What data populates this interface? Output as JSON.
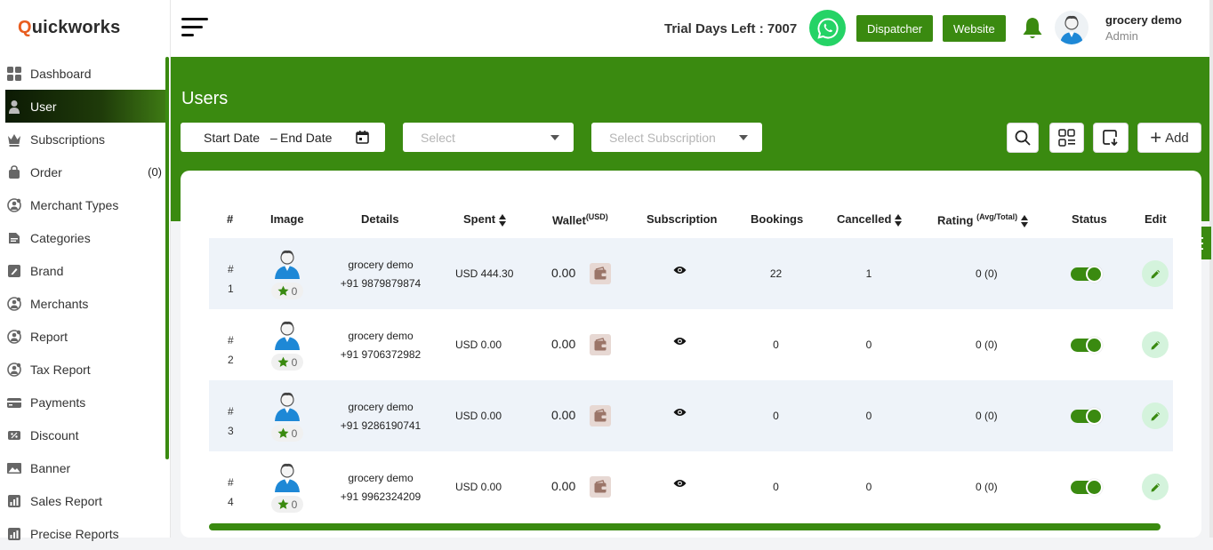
{
  "brand": {
    "q": "Q",
    "rest": "uickworks"
  },
  "sidebar": {
    "items": [
      {
        "label": "Dashboard",
        "icon": "dashboard-icon"
      },
      {
        "label": "User",
        "icon": "user-icon",
        "active": true
      },
      {
        "label": "Subscriptions",
        "icon": "crown-icon"
      },
      {
        "label": "Order",
        "icon": "bag-icon",
        "count": "(0)"
      },
      {
        "label": "Merchant Types",
        "icon": "merchant-type-icon"
      },
      {
        "label": "Categories",
        "icon": "categories-icon"
      },
      {
        "label": "Brand",
        "icon": "brand-icon"
      },
      {
        "label": "Merchants",
        "icon": "merchants-icon"
      },
      {
        "label": "Report",
        "icon": "report-icon"
      },
      {
        "label": "Tax Report",
        "icon": "tax-report-icon"
      },
      {
        "label": "Payments",
        "icon": "payments-icon"
      },
      {
        "label": "Discount",
        "icon": "discount-icon"
      },
      {
        "label": "Banner",
        "icon": "banner-icon"
      },
      {
        "label": "Sales Report",
        "icon": "sales-report-icon"
      },
      {
        "label": "Precise Reports",
        "icon": "precise-reports-icon"
      }
    ]
  },
  "header": {
    "trial": "Trial Days Left : 7007",
    "dispatcher": "Dispatcher",
    "website": "Website",
    "user_name": "grocery demo",
    "user_role": "Admin"
  },
  "page": {
    "title": "Users",
    "start_date": "Start Date",
    "date_sep": "–",
    "end_date": "End Date",
    "select_placeholder": "Select",
    "subscription_placeholder": "Select Subscription",
    "add_label": "Add"
  },
  "table": {
    "headers": {
      "num": "#",
      "image": "Image",
      "details": "Details",
      "spent": "Spent",
      "wallet": "Wallet",
      "wallet_sup": "(USD)",
      "subscription": "Subscription",
      "bookings": "Bookings",
      "cancelled": "Cancelled",
      "rating": "Rating",
      "rating_sup": "(Avg/Total)",
      "status": "Status",
      "edit": "Edit"
    },
    "rows": [
      {
        "hash": "#",
        "num": "1",
        "rating_star": "0",
        "name": "grocery demo",
        "phone": "+91 9879879874",
        "spent": "USD 444.30",
        "wallet": "0.00",
        "bookings": "22",
        "cancelled": "1",
        "rating": "0 (0)",
        "status_on": true
      },
      {
        "hash": "#",
        "num": "2",
        "rating_star": "0",
        "name": "grocery demo",
        "phone": "+91 9706372982",
        "spent": "USD 0.00",
        "wallet": "0.00",
        "bookings": "0",
        "cancelled": "0",
        "rating": "0 (0)",
        "status_on": true
      },
      {
        "hash": "#",
        "num": "3",
        "rating_star": "0",
        "name": "grocery demo",
        "phone": "+91 9286190741",
        "spent": "USD 0.00",
        "wallet": "0.00",
        "bookings": "0",
        "cancelled": "0",
        "rating": "0 (0)",
        "status_on": true
      },
      {
        "hash": "#",
        "num": "4",
        "rating_star": "0",
        "name": "grocery demo",
        "phone": "+91 9962324209",
        "spent": "USD 0.00",
        "wallet": "0.00",
        "bookings": "0",
        "cancelled": "0",
        "rating": "0 (0)",
        "status_on": true
      }
    ]
  },
  "colors": {
    "accent": "#3a8a10",
    "brand_q": "#e85d1f",
    "whatsapp": "#25d366"
  }
}
